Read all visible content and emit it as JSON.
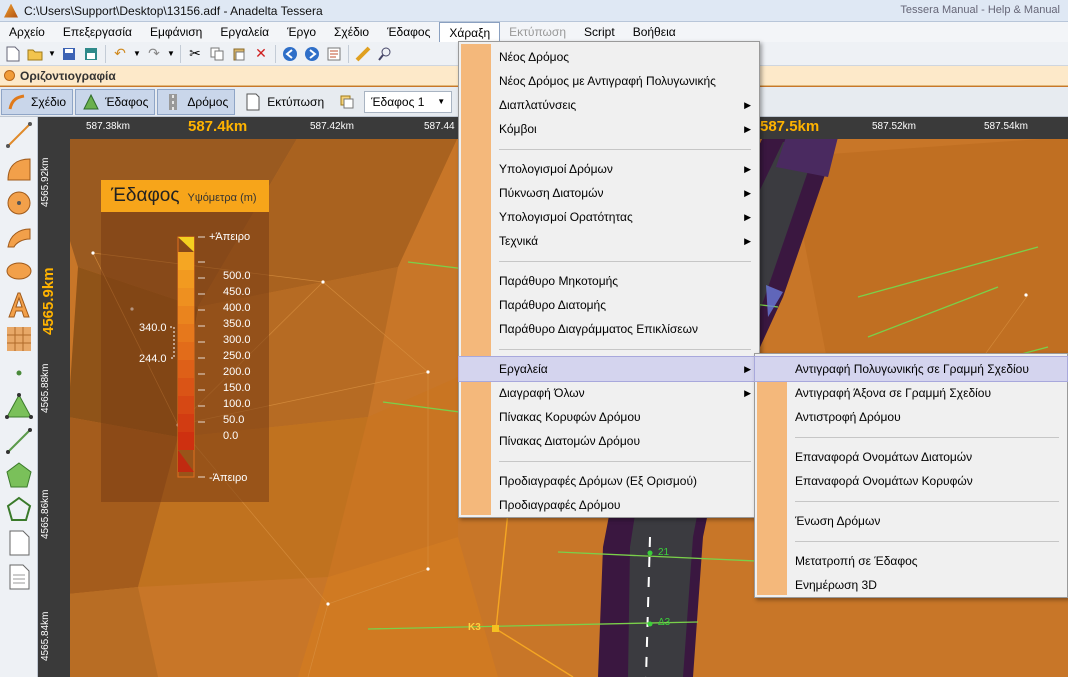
{
  "window": {
    "title": "C:\\Users\\Support\\Desktop\\13156.adf - Anadelta Tessera",
    "right_text": "Tessera Manual - Help & Manual"
  },
  "menubar": [
    {
      "label": "Αρχείο",
      "state": "normal"
    },
    {
      "label": "Επεξεργασία",
      "state": "normal"
    },
    {
      "label": "Εμφάνιση",
      "state": "normal"
    },
    {
      "label": "Εργαλεία",
      "state": "normal"
    },
    {
      "label": "Έργο",
      "state": "normal"
    },
    {
      "label": "Σχέδιο",
      "state": "normal"
    },
    {
      "label": "Έδαφος",
      "state": "normal"
    },
    {
      "label": "Χάραξη",
      "state": "active"
    },
    {
      "label": "Εκτύπωση",
      "state": "disabled"
    },
    {
      "label": "Script",
      "state": "normal"
    },
    {
      "label": "Βοήθεια",
      "state": "normal"
    }
  ],
  "document": {
    "tab_title": "Οριζοντιογραφία"
  },
  "modebar": {
    "modes": [
      {
        "label": "Σχέδιο",
        "selected": true
      },
      {
        "label": "Έδαφος",
        "selected": true
      },
      {
        "label": "Δρόμος",
        "selected": true
      },
      {
        "label": "Εκτύπωση",
        "selected": false
      }
    ],
    "layer": "Έδαφος 1"
  },
  "rulers": {
    "x_ticks": [
      "587.38km",
      "587.4km",
      "587.42km",
      "587.44",
      "587.5km",
      "587.52km",
      "587.54km"
    ],
    "y_ticks": [
      "4565.92km",
      "4565.9km",
      "4565.88km",
      "4565.86km",
      "4565.84km"
    ]
  },
  "legend": {
    "title": "Έδαφος",
    "subtitle": "Υψόμετρα (m)",
    "top_label": "+Άπειρο",
    "bottom_label": "-Άπειρο",
    "scale_values": [
      "500.0",
      "450.0",
      "400.0",
      "350.0",
      "300.0",
      "250.0",
      "200.0",
      "150.0",
      "100.0",
      "50.0",
      "0.0"
    ],
    "range_min": "244.0",
    "range_max": "340.0"
  },
  "map_labels": {
    "node_k3": "K3",
    "station_21": "21",
    "station_d3": "Δ3"
  },
  "menu_main": [
    {
      "label": "Νέος Δρόμος",
      "submenu": false
    },
    {
      "label": "Νέος Δρόμος με Αντιγραφή Πολυγωνικής",
      "submenu": false
    },
    {
      "label": "Διαπλατύνσεις",
      "submenu": true
    },
    {
      "label": "Κόμβοι",
      "submenu": true
    },
    {
      "sep": true
    },
    {
      "label": "Υπολογισμοί Δρόμων",
      "submenu": true
    },
    {
      "label": "Πύκνωση Διατομών",
      "submenu": true
    },
    {
      "label": "Υπολογισμοί Ορατότητας",
      "submenu": true
    },
    {
      "label": "Τεχνικά",
      "submenu": true
    },
    {
      "sep": true
    },
    {
      "label": "Παράθυρο Μηκοτομής",
      "submenu": false
    },
    {
      "label": "Παράθυρο Διατομής",
      "submenu": false
    },
    {
      "label": "Παράθυρο Διαγράμματος Επικλίσεων",
      "submenu": false
    },
    {
      "sep": true
    },
    {
      "label": "Εργαλεία",
      "submenu": true,
      "highlighted": true
    },
    {
      "label": "Διαγραφή Όλων",
      "submenu": true
    },
    {
      "label": "Πίνακας Κορυφών Δρόμου",
      "submenu": false
    },
    {
      "label": "Πίνακας Διατομών Δρόμου",
      "submenu": false
    },
    {
      "sep": true
    },
    {
      "label": "Προδιαγραφές Δρόμων (Εξ Ορισμού)",
      "submenu": false
    },
    {
      "label": "Προδιαγραφές Δρόμου",
      "submenu": false
    }
  ],
  "menu_sub": [
    {
      "label": "Αντιγραφή Πολυγωνικής σε Γραμμή Σχεδίου",
      "highlighted": true
    },
    {
      "label": "Αντιγραφή Άξονα σε Γραμμή Σχεδίου"
    },
    {
      "label": "Αντιστροφή Δρόμου"
    },
    {
      "sep": true
    },
    {
      "label": "Επαναφορά Ονομάτων Διατομών"
    },
    {
      "label": "Επαναφορά Ονομάτων Κορυφών"
    },
    {
      "sep": true
    },
    {
      "label": "Ένωση Δρόμων"
    },
    {
      "sep": true
    },
    {
      "label": "Μετατροπή σε Έδαφος"
    },
    {
      "label": "Ενημέρωση 3D"
    }
  ]
}
